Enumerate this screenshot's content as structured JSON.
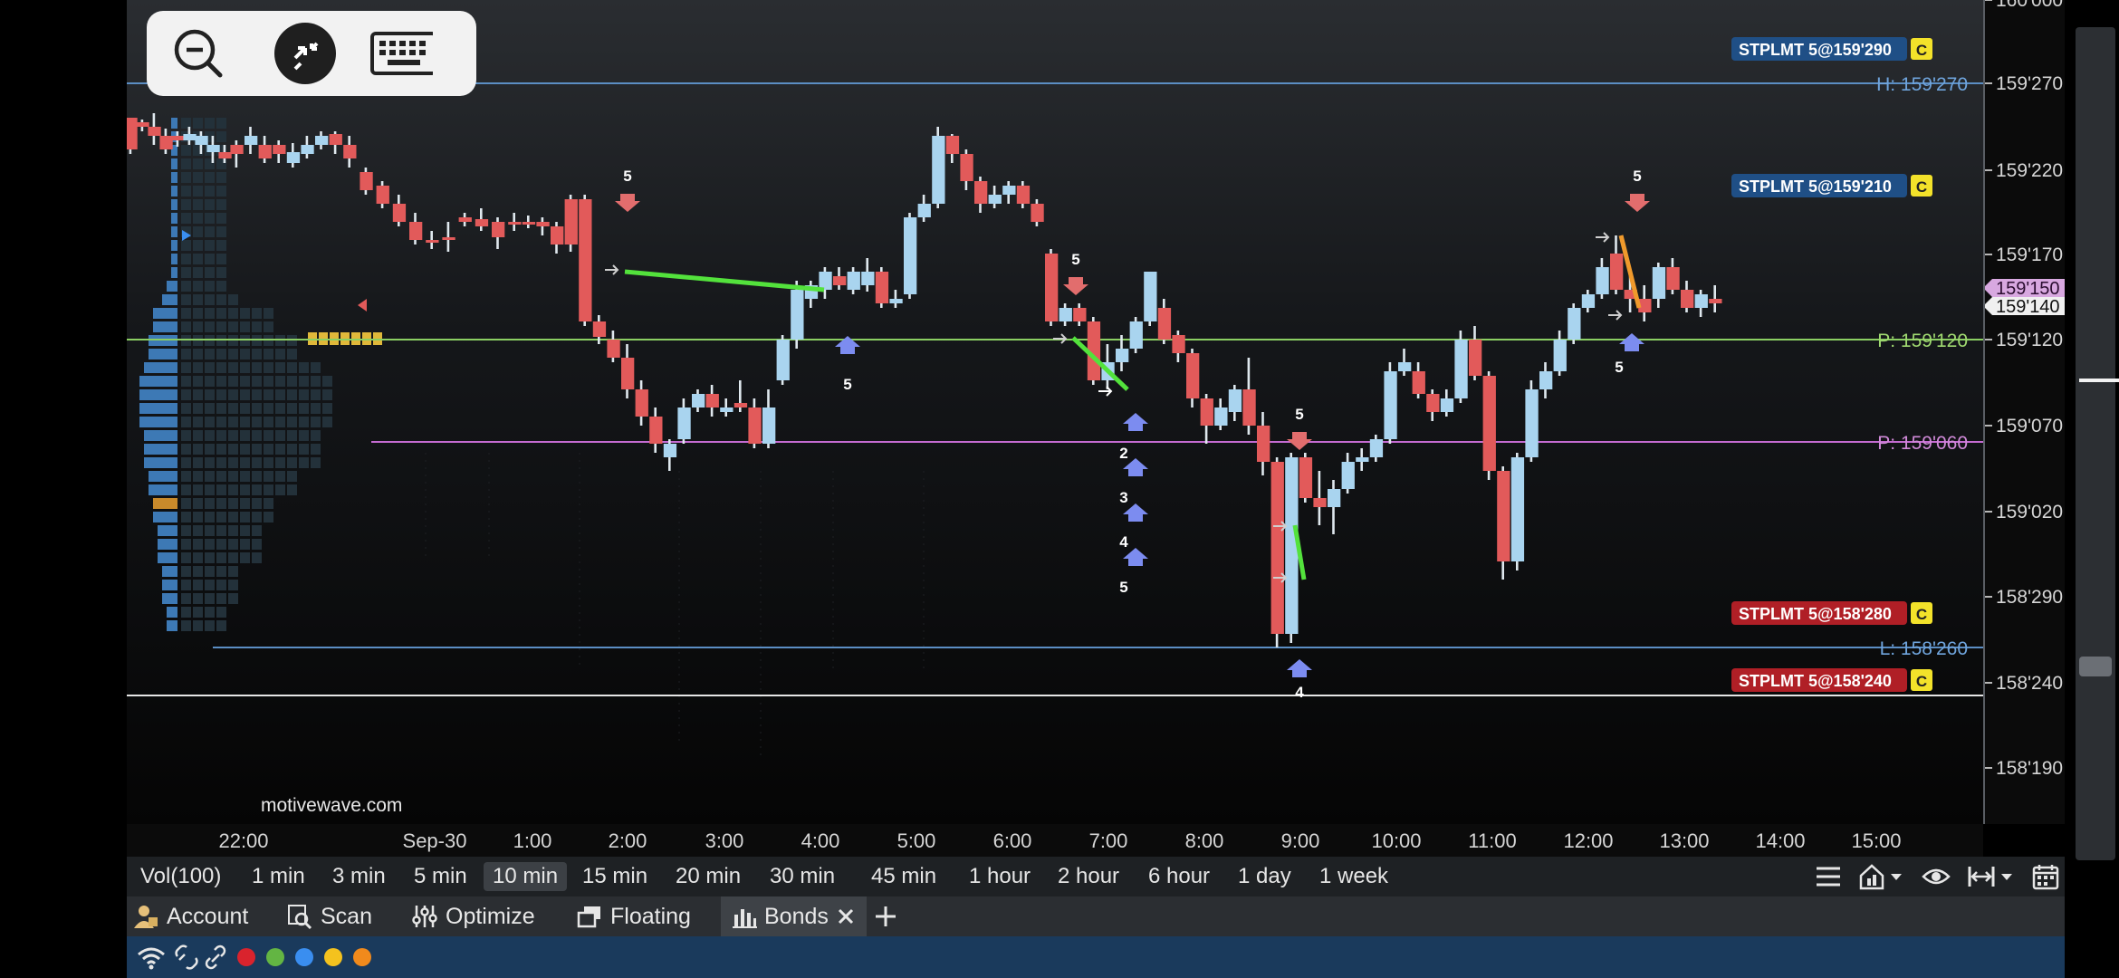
{
  "app": {
    "name": "MotiveWave",
    "watermark": "motivewave.com"
  },
  "overlay_controls": [
    {
      "name": "zoom-out-icon"
    },
    {
      "name": "remote-desktop-icon"
    },
    {
      "name": "keyboard-icon"
    }
  ],
  "price_axis": {
    "ticks": [
      "160'000",
      "159'270",
      "159'220",
      "159'170",
      "159'120",
      "159'070",
      "159'020",
      "158'290",
      "158'240",
      "158'190"
    ],
    "current_price_a": "159'150",
    "current_price_b": "159'140"
  },
  "levels": {
    "high_label": "H: 159'270",
    "pivot_a_label": "P: 159'120",
    "pivot_b_label": "P: 159'060",
    "low_label": "L: 158'260"
  },
  "orders": [
    {
      "label": "STPLMT 5@159'290",
      "tag": "C",
      "side": "buy"
    },
    {
      "label": "STPLMT 5@159'210",
      "tag": "C",
      "side": "buy"
    },
    {
      "label": "STPLMT 5@158'280",
      "tag": "C",
      "side": "sell"
    },
    {
      "label": "STPLMT 5@158'240",
      "tag": "C",
      "side": "sell"
    }
  ],
  "markers": {
    "m5": "5",
    "m2": "2",
    "m3": "3",
    "m4": "4"
  },
  "time_axis": [
    "22:00",
    "Sep-30",
    "1:00",
    "2:00",
    "3:00",
    "4:00",
    "5:00",
    "6:00",
    "7:00",
    "8:00",
    "9:00",
    "10:00",
    "11:00",
    "12:00",
    "13:00",
    "14:00",
    "15:00"
  ],
  "timeframes": [
    "Vol(100)",
    "1 min",
    "3 min",
    "5 min",
    "10 min",
    "15 min",
    "20 min",
    "30 min",
    "45 min",
    "1 hour",
    "2 hour",
    "6 hour",
    "1 day",
    "1 week"
  ],
  "selected_timeframe": "10 min",
  "toolbar_icons": [
    "menu-icon",
    "house-chart-icon",
    "eye-icon",
    "fit-width-icon",
    "calendar-icon"
  ],
  "tabs": [
    {
      "label": "Account",
      "icon": "account-icon"
    },
    {
      "label": "Scan",
      "icon": "scan-icon"
    },
    {
      "label": "Optimize",
      "icon": "optimize-icon"
    },
    {
      "label": "Floating",
      "icon": "floating-icon"
    },
    {
      "label": "Bonds",
      "icon": "bar-chart-icon",
      "active": true
    }
  ],
  "status_colors": [
    "#d9232d",
    "#63b543",
    "#3a8ef0",
    "#f4c21e",
    "#f18a1c"
  ],
  "colors": {
    "up": "#a9d4ef",
    "down": "#e25a5a",
    "accent": "#3a8ef0"
  }
}
